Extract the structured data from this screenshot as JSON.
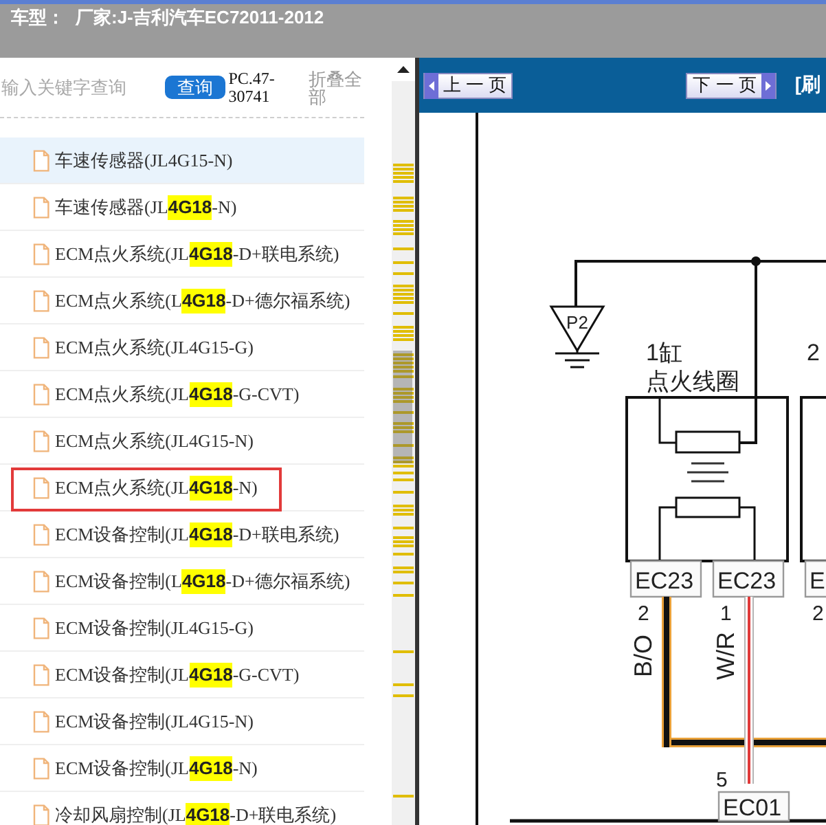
{
  "header": {
    "vehicle_label": "车型：",
    "vehicle_value": "厂家:J-吉利汽车EC72011-2012"
  },
  "sidebar": {
    "search": {
      "placeholder": "输入关键字查询"
    },
    "search_button": "查询",
    "code": "PC.47-30741",
    "collapse_all": "折叠全部",
    "items": [
      {
        "label": "车速传感器(JL4G15-N)",
        "selected": true,
        "outlined": false
      },
      {
        "label": "车速传感器(JL**4G18**-N)",
        "selected": false,
        "outlined": false
      },
      {
        "label": "ECM点火系统(JL**4G18**-D+联电系统)",
        "selected": false,
        "outlined": false
      },
      {
        "label": "ECM点火系统(L**4G18**-D+德尔福系统)",
        "selected": false,
        "outlined": false
      },
      {
        "label": "ECM点火系统(JL4G15-G)",
        "selected": false,
        "outlined": false
      },
      {
        "label": "ECM点火系统(JL**4G18**-G-CVT)",
        "selected": false,
        "outlined": false
      },
      {
        "label": "ECM点火系统(JL4G15-N)",
        "selected": false,
        "outlined": false
      },
      {
        "label": "ECM点火系统(JL**4G18**-N)",
        "selected": false,
        "outlined": true
      },
      {
        "label": "ECM设备控制(JL**4G18**-D+联电系统)",
        "selected": false,
        "outlined": false
      },
      {
        "label": "ECM设备控制(L**4G18**-D+德尔福系统)",
        "selected": false,
        "outlined": false
      },
      {
        "label": "ECM设备控制(JL4G15-G)",
        "selected": false,
        "outlined": false
      },
      {
        "label": "ECM设备控制(JL**4G18**-G-CVT)",
        "selected": false,
        "outlined": false
      },
      {
        "label": "ECM设备控制(JL4G15-N)",
        "selected": false,
        "outlined": false
      },
      {
        "label": "ECM设备控制(JL**4G18**-N)",
        "selected": false,
        "outlined": false
      },
      {
        "label": "冷却风扇控制(JL**4G18**-D+联电系统)",
        "selected": false,
        "outlined": false
      }
    ]
  },
  "viewer": {
    "prev_button": "上 一 页",
    "next_button": "下 一 页",
    "refresh_link": "[刷",
    "diagram": {
      "ground": {
        "label": "P2"
      },
      "coils": [
        {
          "name_lines": [
            "1缸",
            "点火线圈"
          ],
          "connectors": [
            {
              "label": "EC23",
              "pin": "2"
            },
            {
              "label": "EC23",
              "pin": "1"
            }
          ]
        },
        {
          "name_lines": [
            "2"
          ],
          "connectors": [
            {
              "label": "E",
              "pin": "2"
            }
          ]
        }
      ],
      "wires": [
        {
          "code": "B/O",
          "kind": "outlined",
          "color": "#e8a03a"
        },
        {
          "code": "W/R",
          "kind": "striped",
          "color": "#e03a3a"
        }
      ],
      "splice": {
        "label": "EC01",
        "pin": "5"
      }
    }
  }
}
